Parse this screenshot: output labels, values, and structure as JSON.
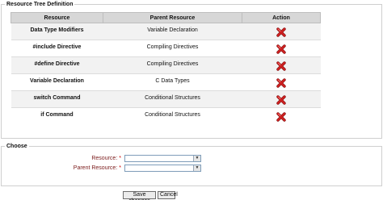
{
  "tree": {
    "legend": "Resource Tree Definition",
    "columns": [
      "Resource",
      "Parent Resource",
      "Action"
    ],
    "rows": [
      {
        "resource": "Data Type Modifiers",
        "parent": "Variable Declaration"
      },
      {
        "resource": "#include Directive",
        "parent": "Compiling Directives"
      },
      {
        "resource": "#define Directive",
        "parent": "Compiling Directives"
      },
      {
        "resource": "Variable Declaration",
        "parent": "C Data Types"
      },
      {
        "resource": "switch Command",
        "parent": "Conditional Structures"
      },
      {
        "resource": "if Command",
        "parent": "Conditional Structures"
      }
    ],
    "delete_icon": "delete-x-icon",
    "delete_color": "#cc1f1f"
  },
  "choose": {
    "legend": "Choose",
    "resource_label": "Resource:",
    "parent_label": "Parent Resource:",
    "required_mark": "*",
    "resource_value": "",
    "parent_value": ""
  },
  "buttons": {
    "save": "Save changes",
    "cancel": "Cancel"
  }
}
